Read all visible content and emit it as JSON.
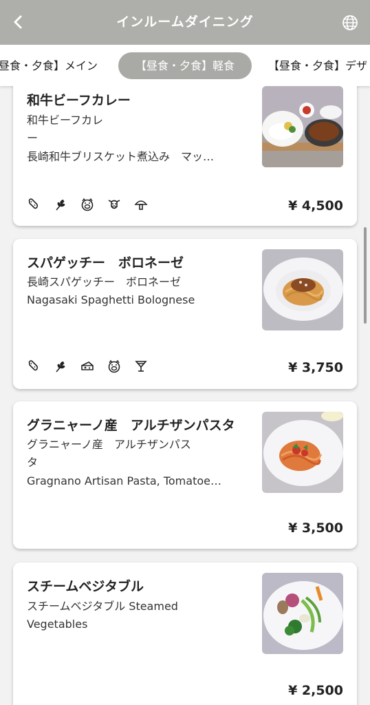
{
  "header": {
    "title": "インルームダイニング",
    "back_icon": "chevron-left-icon",
    "globe_icon": "globe-icon"
  },
  "tabs": [
    {
      "label": "昼食・夕食】メイン",
      "active": false
    },
    {
      "label": "【昼食・夕食】軽食",
      "active": true
    },
    {
      "label": "【昼食・夕食】デザ",
      "active": false
    }
  ],
  "menu": [
    {
      "name": "和牛ビーフカレー",
      "desc_line1": "和牛ビーフカレ",
      "desc_line2": "ー",
      "desc_line3": "長崎和牛ブリスケット煮込み　マッ…",
      "allergen_icons": [
        "peanut-icon",
        "wheat-icon",
        "pig-icon",
        "cow-icon",
        "mushroom-icon"
      ],
      "price": "¥ 4,500"
    },
    {
      "name": "スパゲッチー　ボロネーゼ",
      "desc_line1": "長崎スパゲッチー　ボロネーゼ",
      "desc_line2": "Nagasaki Spaghetti Bolognese",
      "allergen_icons": [
        "peanut-icon",
        "wheat-icon",
        "cheese-icon",
        "pig-icon",
        "cocktail-icon"
      ],
      "price": "¥ 3,750"
    },
    {
      "name": "グラニャーノ産　アルチザンパスタ",
      "desc_line1": "グラニャーノ産　アルチザンパス",
      "desc_line2": "タ",
      "desc_line3": "Gragnano Artisan Pasta, Tomatoes…",
      "price": "¥ 3,500"
    },
    {
      "name": "スチームベジタブル",
      "desc_line1": "スチームベジタブル Steamed",
      "desc_line2": "Vegetables",
      "price": "¥ 2,500"
    }
  ]
}
